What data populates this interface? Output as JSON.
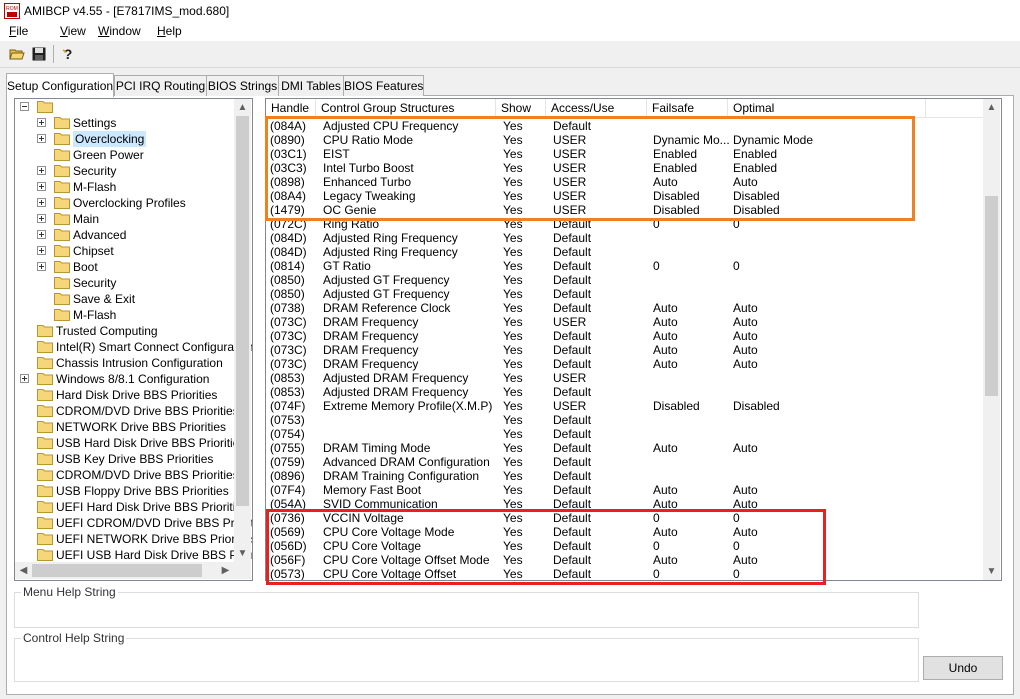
{
  "window": {
    "title": "AMIBCP v4.55 - [E7817IMS_mod.680]",
    "app_icon": "amibcp-rom-icon"
  },
  "menu": [
    "File",
    "View",
    "Window",
    "Help"
  ],
  "toolbar": {
    "buttons": [
      "open-folder-icon",
      "save-disk-icon",
      "help-question-icon"
    ]
  },
  "tabs": [
    {
      "label": "Setup Configuration",
      "active": true
    },
    {
      "label": "PCI IRQ Routing",
      "active": false
    },
    {
      "label": "BIOS Strings",
      "active": false
    },
    {
      "label": "DMI Tables",
      "active": false
    },
    {
      "label": "BIOS Features",
      "active": false
    }
  ],
  "tree": {
    "items": [
      {
        "label": "",
        "level": 0,
        "expander": "minus"
      },
      {
        "label": "Settings",
        "level": 1,
        "expander": "plus"
      },
      {
        "label": "Overclocking",
        "level": 1,
        "expander": "plus",
        "selected": true
      },
      {
        "label": "Green Power",
        "level": 1,
        "expander": "none"
      },
      {
        "label": "Security",
        "level": 1,
        "expander": "plus"
      },
      {
        "label": "M-Flash",
        "level": 1,
        "expander": "plus"
      },
      {
        "label": "Overclocking Profiles",
        "level": 1,
        "expander": "plus"
      },
      {
        "label": "Main",
        "level": 1,
        "expander": "plus"
      },
      {
        "label": "Advanced",
        "level": 1,
        "expander": "plus"
      },
      {
        "label": "Chipset",
        "level": 1,
        "expander": "plus"
      },
      {
        "label": "Boot",
        "level": 1,
        "expander": "plus"
      },
      {
        "label": "Security",
        "level": 1,
        "expander": "none"
      },
      {
        "label": "Save & Exit",
        "level": 1,
        "expander": "none"
      },
      {
        "label": "M-Flash",
        "level": 1,
        "expander": "none"
      },
      {
        "label": "Trusted Computing",
        "level": 0,
        "expander": "none"
      },
      {
        "label": "Intel(R) Smart Connect Configuration",
        "level": 0,
        "expander": "none"
      },
      {
        "label": "Chassis Intrusion Configuration",
        "level": 0,
        "expander": "none"
      },
      {
        "label": "Windows 8/8.1 Configuration",
        "level": 0,
        "expander": "plus"
      },
      {
        "label": "Hard Disk Drive BBS Priorities",
        "level": 0,
        "expander": "none"
      },
      {
        "label": "CDROM/DVD Drive BBS Priorities",
        "level": 0,
        "expander": "none"
      },
      {
        "label": "NETWORK Drive BBS Priorities",
        "level": 0,
        "expander": "none"
      },
      {
        "label": "USB Hard Disk Drive BBS Priorities",
        "level": 0,
        "expander": "none"
      },
      {
        "label": "USB Key Drive BBS Priorities",
        "level": 0,
        "expander": "none"
      },
      {
        "label": "CDROM/DVD Drive BBS Priorities",
        "level": 0,
        "expander": "none"
      },
      {
        "label": "USB Floppy Drive BBS Priorities",
        "level": 0,
        "expander": "none"
      },
      {
        "label": "UEFI Hard Disk Drive BBS Priorities",
        "level": 0,
        "expander": "none"
      },
      {
        "label": "UEFI CDROM/DVD Drive BBS Priorit",
        "level": 0,
        "expander": "none"
      },
      {
        "label": "UEFI NETWORK Drive BBS Priorities",
        "level": 0,
        "expander": "none"
      },
      {
        "label": "UEFI USB Hard Disk Drive BBS Priori",
        "level": 0,
        "expander": "none"
      }
    ]
  },
  "table": {
    "columns": [
      "Handle",
      "Control Group Structures",
      "Show",
      "Access/Use",
      "Failsafe",
      "Optimal"
    ],
    "rows": [
      [
        "(084A)",
        "Adjusted CPU Frequency",
        "Yes",
        "Default",
        "",
        ""
      ],
      [
        "(0890)",
        "CPU Ratio Mode",
        "Yes",
        "USER",
        "Dynamic Mo...",
        "Dynamic Mode"
      ],
      [
        "(03C1)",
        "EIST",
        "Yes",
        "USER",
        "Enabled",
        "Enabled"
      ],
      [
        "(03C3)",
        "Intel Turbo Boost",
        "Yes",
        "USER",
        "Enabled",
        "Enabled"
      ],
      [
        "(0898)",
        "Enhanced Turbo",
        "Yes",
        "USER",
        "Auto",
        "Auto"
      ],
      [
        "(08A4)",
        "Legacy Tweaking",
        "Yes",
        "USER",
        "Disabled",
        "Disabled"
      ],
      [
        "(1479)",
        "OC Genie",
        "Yes",
        "USER",
        "Disabled",
        "Disabled"
      ],
      [
        "(072C)",
        "Ring Ratio",
        "Yes",
        "Default",
        "0",
        "0"
      ],
      [
        "(084D)",
        "Adjusted Ring Frequency",
        "Yes",
        "Default",
        "",
        ""
      ],
      [
        "(084D)",
        "Adjusted Ring Frequency",
        "Yes",
        "Default",
        "",
        ""
      ],
      [
        "(0814)",
        "GT Ratio",
        "Yes",
        "Default",
        "0",
        "0"
      ],
      [
        "(0850)",
        "Adjusted GT Frequency",
        "Yes",
        "Default",
        "",
        ""
      ],
      [
        "(0850)",
        "Adjusted GT Frequency",
        "Yes",
        "Default",
        "",
        ""
      ],
      [
        "(0738)",
        "DRAM Reference Clock",
        "Yes",
        "Default",
        "Auto",
        "Auto"
      ],
      [
        "(073C)",
        "DRAM Frequency",
        "Yes",
        "USER",
        "Auto",
        "Auto"
      ],
      [
        "(073C)",
        "DRAM Frequency",
        "Yes",
        "Default",
        "Auto",
        "Auto"
      ],
      [
        "(073C)",
        "DRAM Frequency",
        "Yes",
        "Default",
        "Auto",
        "Auto"
      ],
      [
        "(073C)",
        "DRAM Frequency",
        "Yes",
        "Default",
        "Auto",
        "Auto"
      ],
      [
        "(0853)",
        "Adjusted DRAM Frequency",
        "Yes",
        "USER",
        "",
        ""
      ],
      [
        "(0853)",
        "Adjusted DRAM Frequency",
        "Yes",
        "Default",
        "",
        ""
      ],
      [
        "(074F)",
        "Extreme Memory Profile(X.M.P)",
        "Yes",
        "USER",
        "Disabled",
        "Disabled"
      ],
      [
        "(0753)",
        "",
        "Yes",
        "Default",
        "",
        ""
      ],
      [
        "(0754)",
        "",
        "Yes",
        "Default",
        "",
        ""
      ],
      [
        "(0755)",
        "DRAM Timing Mode",
        "Yes",
        "Default",
        "Auto",
        "Auto"
      ],
      [
        "(0759)",
        "Advanced DRAM Configuration",
        "Yes",
        "Default",
        "",
        ""
      ],
      [
        "(0896)",
        "DRAM Training Configuration",
        "Yes",
        "Default",
        "",
        ""
      ],
      [
        "(07F4)",
        "Memory Fast Boot",
        "Yes",
        "Default",
        "Auto",
        "Auto"
      ],
      [
        "(054A)",
        "SVID Communication",
        "Yes",
        "Default",
        "Auto",
        "Auto"
      ],
      [
        "(0736)",
        "VCCIN Voltage",
        "Yes",
        "Default",
        "0",
        "0"
      ],
      [
        "(0569)",
        "CPU Core Voltage Mode",
        "Yes",
        "Default",
        "Auto",
        "Auto"
      ],
      [
        "(056D)",
        "CPU Core Voltage",
        "Yes",
        "Default",
        "0",
        "0"
      ],
      [
        "(056F)",
        "CPU Core Voltage Offset Mode",
        "Yes",
        "Default",
        "Auto",
        "Auto"
      ],
      [
        "(0573)",
        "CPU Core Voltage Offset",
        "Yes",
        "Default",
        "0",
        "0"
      ]
    ]
  },
  "highlights": {
    "orange": "#f08020",
    "red": "#e82020"
  },
  "help": {
    "menu_help_label": "Menu Help String",
    "control_help_label": "Control Help String"
  },
  "undo_label": "Undo"
}
